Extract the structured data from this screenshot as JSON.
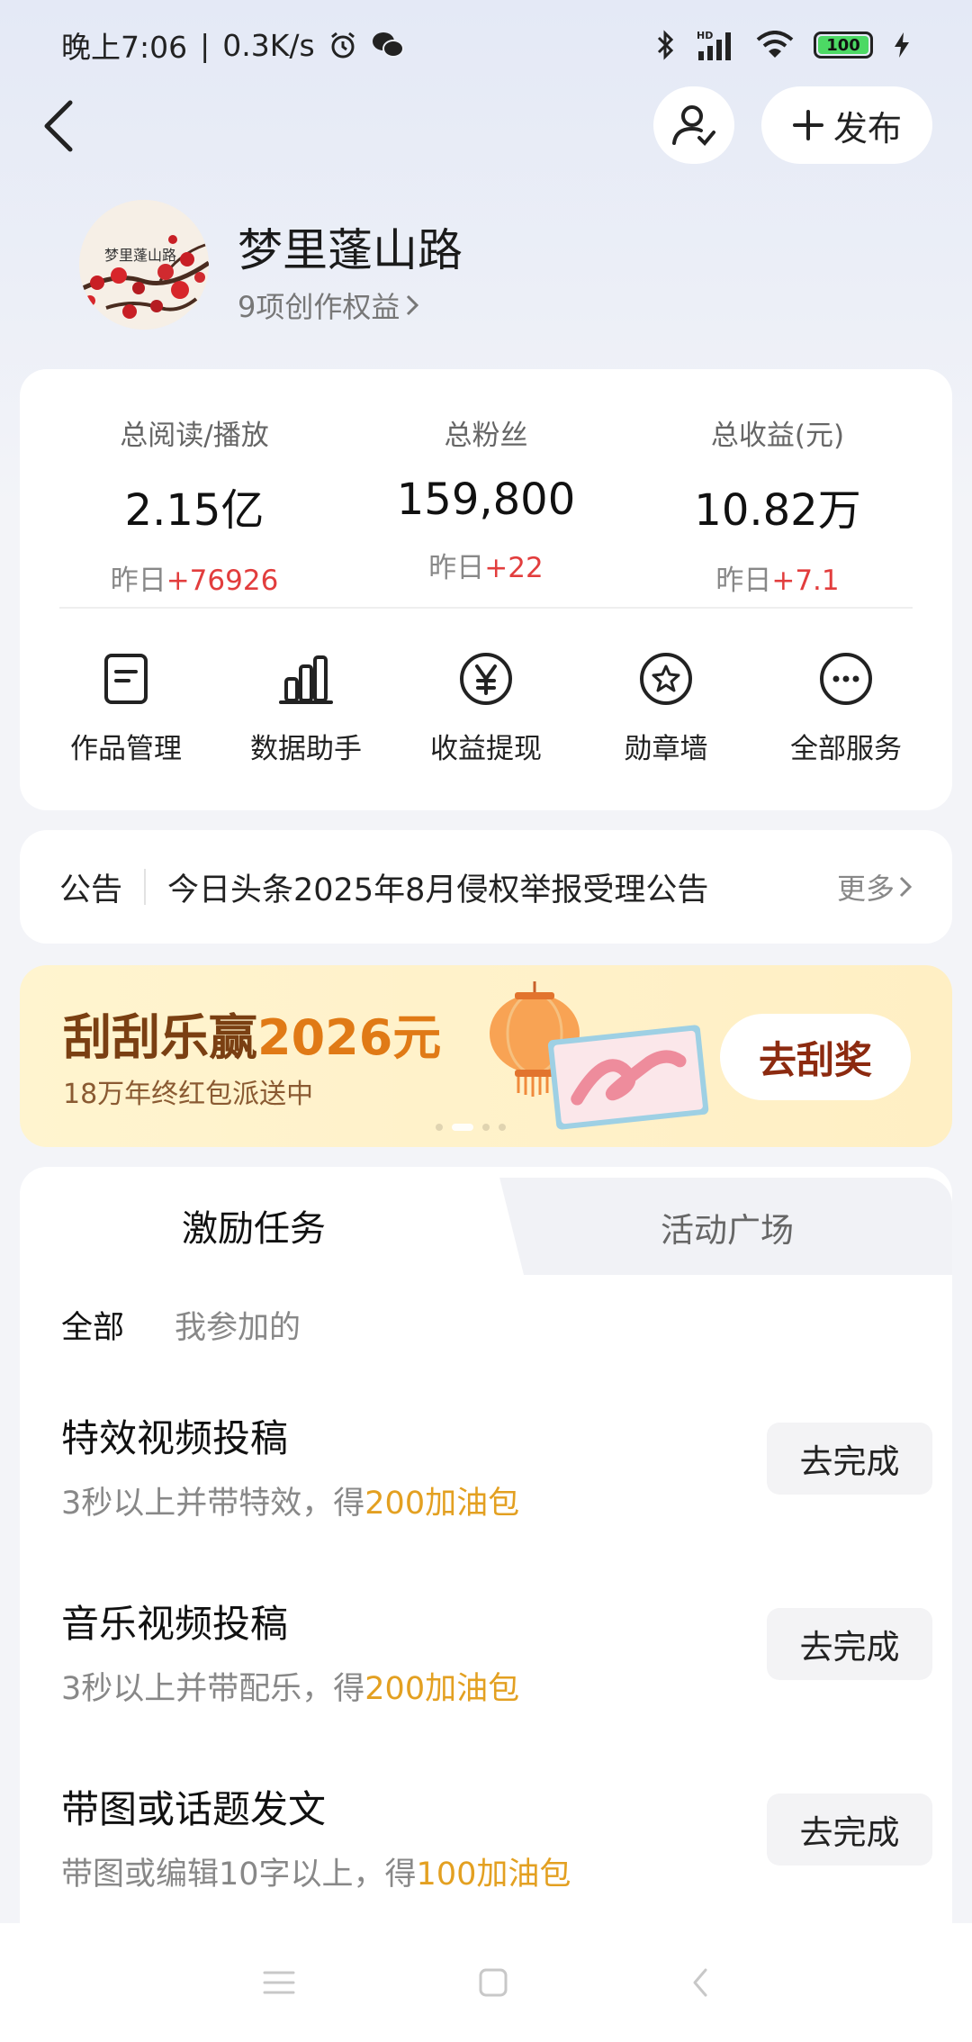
{
  "status_bar": {
    "time": "晚上7:06",
    "network_speed": "0.3K/s",
    "battery": "100",
    "icons": [
      "alarm-icon",
      "wechat-icon",
      "bluetooth-icon",
      "signal-icon",
      "wifi-icon",
      "battery-icon",
      "charging-icon"
    ]
  },
  "header": {
    "publish_label": "发布"
  },
  "profile": {
    "avatar_text": "梦里蓬山路",
    "name": "梦里蓬山路",
    "benefits": "9项创作权益"
  },
  "stats": [
    {
      "label": "总阅读/播放",
      "value": "2.15亿",
      "delta_prefix": "昨日",
      "delta": "+76926"
    },
    {
      "label": "总粉丝",
      "value": "159,800",
      "delta_prefix": "昨日",
      "delta": "+22"
    },
    {
      "label": "总收益(元)",
      "value": "10.82万",
      "delta_prefix": "昨日",
      "delta": "+7.1"
    }
  ],
  "services": [
    {
      "label": "作品管理",
      "icon": "document-icon"
    },
    {
      "label": "数据助手",
      "icon": "bar-chart-icon"
    },
    {
      "label": "收益提现",
      "icon": "yuan-icon"
    },
    {
      "label": "勋章墙",
      "icon": "medal-icon"
    },
    {
      "label": "全部服务",
      "icon": "more-icon"
    }
  ],
  "notice": {
    "tag": "公告",
    "text": "今日头条2025年8月侵权举报受理公告",
    "more": "更多"
  },
  "banner": {
    "title_prefix": "刮刮乐赢",
    "title_amount": "2026元",
    "subtitle": "18万年终红包派送中",
    "button": "去刮奖",
    "page_count": 4,
    "active_page": 2
  },
  "tasks": {
    "tabs": [
      "激励任务",
      "活动广场"
    ],
    "filters": [
      "全部",
      "我参加的"
    ],
    "items": [
      {
        "title": "特效视频投稿",
        "desc": "3秒以上并带特效，得",
        "reward": "200加油包",
        "button": "去完成"
      },
      {
        "title": "音乐视频投稿",
        "desc": "3秒以上并带配乐，得",
        "reward": "200加油包",
        "button": "去完成"
      },
      {
        "title": "带图或话题发文",
        "desc": "带图或编辑10字以上，得",
        "reward": "100加油包",
        "button": "去完成"
      }
    ]
  },
  "colors": {
    "accent_red": "#e23d3d",
    "reward_orange": "#e3a021",
    "banner_brown": "#7a3f12",
    "banner_orange": "#e07a16"
  }
}
